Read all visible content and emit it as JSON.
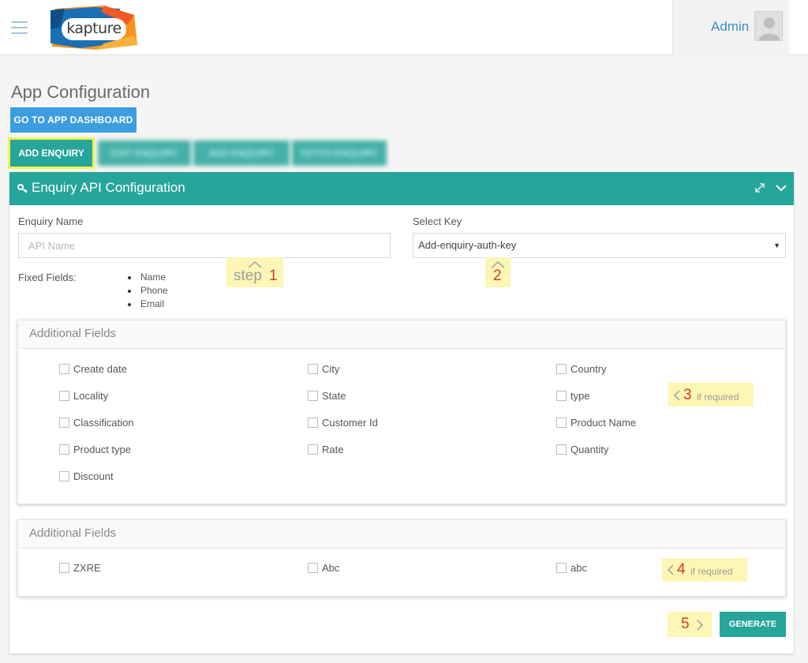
{
  "header": {
    "logo_text": "kapture",
    "user_name": "Admin"
  },
  "page": {
    "title": "App Configuration",
    "dashboard_button": "GO TO APP DASHBOARD"
  },
  "tabs": [
    {
      "label": "ADD ENQUIRY",
      "active": true
    },
    {
      "label": "EDIT ENQUIRY",
      "active": false
    },
    {
      "label": "ADD ENQUIRY",
      "active": false
    },
    {
      "label": "FETCH ENQUIRY",
      "active": false
    }
  ],
  "panel": {
    "title": "Enquiry API Configuration",
    "enquiry_name_label": "Enquiry Name",
    "enquiry_name_placeholder": "API Name",
    "select_key_label": "Select Key",
    "select_key_value": "Add-enquiry-auth-key",
    "fixed_fields_label": "Fixed Fields:",
    "fixed_fields": [
      "Name",
      "Phone",
      "Email"
    ]
  },
  "annotations": {
    "step1_word": "step",
    "step1_num": "1",
    "step2_num": "2",
    "step3_num": "3",
    "step4_num": "4",
    "step5_num": "5",
    "if_required": "if required"
  },
  "additional_fields_1": {
    "title": "Additional Fields",
    "fields": [
      "Create date",
      "City",
      "Country",
      "Locality",
      "State",
      "type",
      "Classification",
      "Customer Id",
      "Product Name",
      "Product type",
      "Rate",
      "Quantity",
      "Discount"
    ]
  },
  "additional_fields_2": {
    "title": "Additional Fields",
    "fields": [
      "ZXRE",
      "Abc",
      "abc"
    ]
  },
  "generate_button": "GENERATE",
  "colors": {
    "teal": "#26a59a",
    "blue": "#3c9ddf",
    "highlight_yellow": "#fdf6b4",
    "annotation_red": "#d23b2a",
    "active_border": "#f3f54a"
  }
}
